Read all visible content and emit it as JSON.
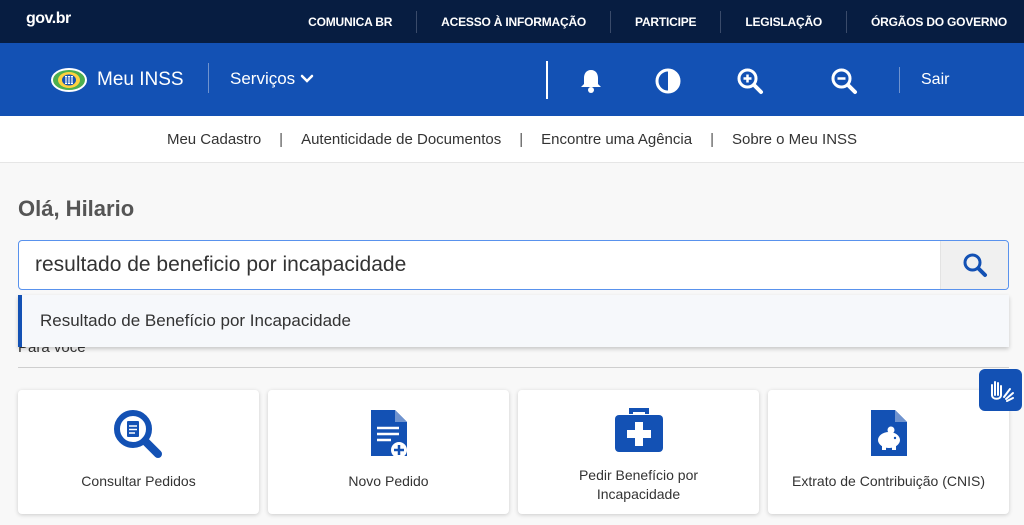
{
  "govbar": {
    "logo": "gov.br",
    "links": [
      "COMUNICA BR",
      "ACESSO À INFORMAÇÃO",
      "PARTICIPE",
      "LEGISLAÇÃO",
      "ÓRGÃOS DO GOVERNO"
    ]
  },
  "header": {
    "brand": "Meu INSS",
    "servicos": "Serviços",
    "sair": "Sair",
    "icons": [
      "bell-icon",
      "contrast-icon",
      "zoom-in-icon",
      "zoom-out-icon"
    ]
  },
  "subnav": {
    "items": [
      "Meu Cadastro",
      "Autenticidade de Documentos",
      "Encontre uma Agência",
      "Sobre o Meu INSS"
    ]
  },
  "greeting": "Olá, Hilario",
  "search": {
    "value": "resultado de beneficio por incapacidade",
    "suggestion": "Resultado de Benefício por Incapacidade"
  },
  "section_title": "Para você",
  "cards": [
    {
      "label": "Consultar Pedidos",
      "icon": "search-document-icon"
    },
    {
      "label": "Novo Pedido",
      "icon": "new-document-icon"
    },
    {
      "label": "Pedir Benefício por Incapacidade",
      "icon": "medical-kit-icon"
    },
    {
      "label": "Extrato de Contribuição (CNIS)",
      "icon": "piggy-bank-document-icon"
    }
  ],
  "colors": {
    "gov_navy": "#071d41",
    "primary_blue": "#1351b4"
  }
}
